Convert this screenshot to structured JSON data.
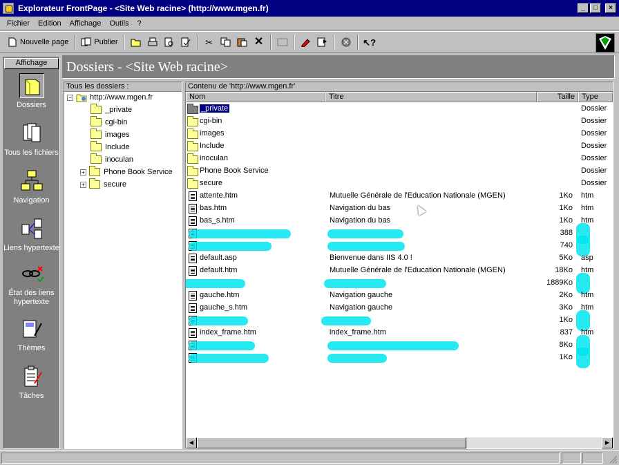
{
  "window": {
    "title": "Explorateur FrontPage - <Site Web racine> (http://www.mgen.fr)"
  },
  "menu": [
    "Fichier",
    "Edition",
    "Affichage",
    "Outils",
    "?"
  ],
  "toolbar": {
    "new_page": "Nouvelle page",
    "publish": "Publier"
  },
  "views": {
    "header": "Affichage",
    "items": [
      {
        "label": "Dossiers",
        "icon": "folder-icon"
      },
      {
        "label": "Tous les fichiers",
        "icon": "all-files-icon"
      },
      {
        "label": "Navigation",
        "icon": "navigation-icon"
      },
      {
        "label": "Liens hypertexte",
        "icon": "hyperlinks-icon"
      },
      {
        "label": "État des liens hypertexte",
        "icon": "hyperlink-status-icon"
      },
      {
        "label": "Thèmes",
        "icon": "themes-icon"
      },
      {
        "label": "Tâches",
        "icon": "tasks-icon"
      }
    ]
  },
  "heading": "Dossiers - <Site Web racine>",
  "tree": {
    "header": "Tous les dossiers :",
    "root": "http://www.mgen.fr",
    "items": [
      {
        "label": "_private",
        "expandable": false
      },
      {
        "label": "cgi-bin",
        "expandable": false
      },
      {
        "label": "images",
        "expandable": false
      },
      {
        "label": "Include",
        "expandable": false
      },
      {
        "label": "inoculan",
        "expandable": false
      },
      {
        "label": "Phone Book Service",
        "expandable": true
      },
      {
        "label": "secure",
        "expandable": true
      }
    ]
  },
  "contents": {
    "header": "Contenu de 'http://www.mgen.fr'",
    "columns": [
      "Nom",
      "Titre",
      "Taille",
      "Type"
    ],
    "rows": [
      {
        "name": "_private",
        "title": "",
        "size": "",
        "type": "Dossier",
        "kind": "folder",
        "selected": true
      },
      {
        "name": "cgi-bin",
        "title": "",
        "size": "",
        "type": "Dossier",
        "kind": "folder"
      },
      {
        "name": "images",
        "title": "",
        "size": "",
        "type": "Dossier",
        "kind": "folder"
      },
      {
        "name": "Include",
        "title": "",
        "size": "",
        "type": "Dossier",
        "kind": "folder"
      },
      {
        "name": "inoculan",
        "title": "",
        "size": "",
        "type": "Dossier",
        "kind": "folder"
      },
      {
        "name": "Phone Book Service",
        "title": "",
        "size": "",
        "type": "Dossier",
        "kind": "folder"
      },
      {
        "name": "secure",
        "title": "",
        "size": "",
        "type": "Dossier",
        "kind": "folder"
      },
      {
        "name": "attente.htm",
        "title": "Mutuelle Générale de l'Education Nationale (MGEN)",
        "size": "1Ko",
        "type": "htm",
        "kind": "file"
      },
      {
        "name": "bas.htm",
        "title": "Navigation du bas",
        "size": "1Ko",
        "type": "htm",
        "kind": "file"
      },
      {
        "name": "bas_s.htm",
        "title": "Navigation du bas",
        "size": "1Ko",
        "type": "htm",
        "kind": "file"
      },
      {
        "name": "",
        "title": "",
        "size": "388",
        "type": "",
        "kind": "file",
        "redacted": true
      },
      {
        "name": "",
        "title": "",
        "size": "740",
        "type": "",
        "kind": "file",
        "redacted": true
      },
      {
        "name": "default.asp",
        "title": "Bienvenue dans IIS 4.0 !",
        "size": "5Ko",
        "type": "asp",
        "kind": "file"
      },
      {
        "name": "default.htm",
        "title": "Mutuelle Générale de l'Education Nationale (MGEN)",
        "size": "18Ko",
        "type": "htm",
        "kind": "file"
      },
      {
        "name": "",
        "title": "",
        "size": "1889Ko",
        "type": "",
        "kind": "none",
        "redacted": true
      },
      {
        "name": "gauche.htm",
        "title": "Navigation gauche",
        "size": "2Ko",
        "type": "htm",
        "kind": "file"
      },
      {
        "name": "gauche_s.htm",
        "title": "Navigation gauche",
        "size": "3Ko",
        "type": "htm",
        "kind": "file"
      },
      {
        "name": "",
        "title": "",
        "size": "1Ko",
        "type": "",
        "kind": "file",
        "redacted": true
      },
      {
        "name": "index_frame.htm",
        "title": "index_frame.htm",
        "size": "837",
        "type": "htm",
        "kind": "file"
      },
      {
        "name": "",
        "title": "",
        "size": "8Ko",
        "type": "",
        "kind": "file",
        "redacted": true
      },
      {
        "name": "",
        "title": "",
        "size": "1Ko",
        "type": "",
        "kind": "file",
        "redacted": true
      }
    ]
  },
  "colors": {
    "titlebar": "#000080",
    "face": "#c0c0c0",
    "shadow": "#808080",
    "redaction": "#00e5ee"
  }
}
